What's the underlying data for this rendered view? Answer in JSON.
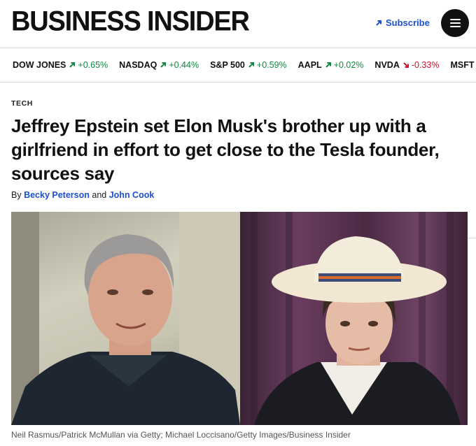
{
  "header": {
    "logo": "BUSINESS INSIDER",
    "subscribe_label": "Subscribe"
  },
  "ticker": [
    {
      "symbol": "DOW JONES",
      "change": "+0.65%",
      "direction": "up"
    },
    {
      "symbol": "NASDAQ",
      "change": "+0.44%",
      "direction": "up"
    },
    {
      "symbol": "S&P 500",
      "change": "+0.59%",
      "direction": "up"
    },
    {
      "symbol": "AAPL",
      "change": "+0.02%",
      "direction": "up"
    },
    {
      "symbol": "NVDA",
      "change": "-0.33%",
      "direction": "down"
    },
    {
      "symbol": "MSFT",
      "change": "",
      "direction": "up"
    }
  ],
  "article": {
    "section": "TECH",
    "headline": "Jeffrey Epstein set Elon Musk's brother up with a girlfriend in effort to get close to the Tesla founder, sources say",
    "byline_prefix": "By",
    "author_1": "Becky Peterson",
    "byline_joiner": "and",
    "author_2": "John Cook",
    "caption": "Neil Rasmus/Patrick McMullan via Getty; Michael Loccisano/Getty Images/Business Insider"
  },
  "colors": {
    "link": "#1c4fd1",
    "up": "#118a3e",
    "down": "#d0112b"
  }
}
